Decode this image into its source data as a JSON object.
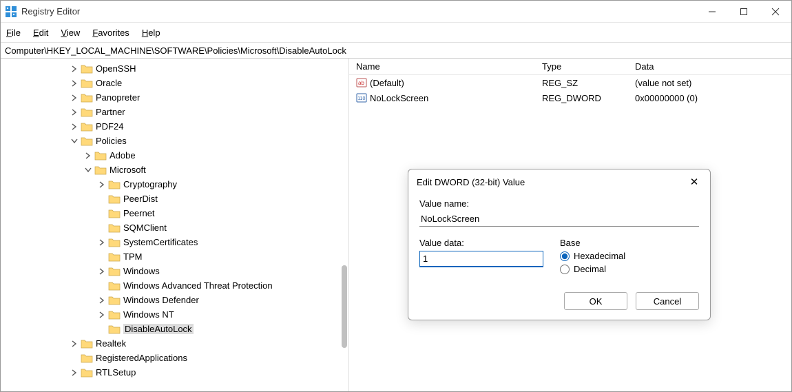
{
  "window": {
    "title": "Registry Editor"
  },
  "menu": {
    "file": "File",
    "edit": "Edit",
    "view": "View",
    "favorites": "Favorites",
    "help": "Help"
  },
  "address": "Computer\\HKEY_LOCAL_MACHINE\\SOFTWARE\\Policies\\Microsoft\\DisableAutoLock",
  "tree": {
    "items": [
      {
        "label": "OpenSSH",
        "depth": 3,
        "chev": ">"
      },
      {
        "label": "Oracle",
        "depth": 3,
        "chev": ">"
      },
      {
        "label": "Panopreter",
        "depth": 3,
        "chev": ">"
      },
      {
        "label": "Partner",
        "depth": 3,
        "chev": ">"
      },
      {
        "label": "PDF24",
        "depth": 3,
        "chev": ">"
      },
      {
        "label": "Policies",
        "depth": 3,
        "chev": "v"
      },
      {
        "label": "Adobe",
        "depth": 4,
        "chev": ">"
      },
      {
        "label": "Microsoft",
        "depth": 4,
        "chev": "v"
      },
      {
        "label": "Cryptography",
        "depth": 5,
        "chev": ">"
      },
      {
        "label": "PeerDist",
        "depth": 5,
        "chev": ""
      },
      {
        "label": "Peernet",
        "depth": 5,
        "chev": ""
      },
      {
        "label": "SQMClient",
        "depth": 5,
        "chev": ""
      },
      {
        "label": "SystemCertificates",
        "depth": 5,
        "chev": ">"
      },
      {
        "label": "TPM",
        "depth": 5,
        "chev": ""
      },
      {
        "label": "Windows",
        "depth": 5,
        "chev": ">"
      },
      {
        "label": "Windows Advanced Threat Protection",
        "depth": 5,
        "chev": ""
      },
      {
        "label": "Windows Defender",
        "depth": 5,
        "chev": ">"
      },
      {
        "label": "Windows NT",
        "depth": 5,
        "chev": ">"
      },
      {
        "label": "DisableAutoLock",
        "depth": 5,
        "chev": "",
        "selected": true
      },
      {
        "label": "Realtek",
        "depth": 3,
        "chev": ">"
      },
      {
        "label": "RegisteredApplications",
        "depth": 3,
        "chev": ""
      },
      {
        "label": "RTLSetup",
        "depth": 3,
        "chev": ">"
      }
    ]
  },
  "values": {
    "headers": {
      "name": "Name",
      "type": "Type",
      "data": "Data"
    },
    "rows": [
      {
        "icon": "sz",
        "name": "(Default)",
        "type": "REG_SZ",
        "data": "(value not set)"
      },
      {
        "icon": "dw",
        "name": "NoLockScreen",
        "type": "REG_DWORD",
        "data": "0x00000000 (0)"
      }
    ]
  },
  "dialog": {
    "title": "Edit DWORD (32-bit) Value",
    "valueNameLabel": "Value name:",
    "valueName": "NoLockScreen",
    "valueDataLabel": "Value data:",
    "valueData": "1",
    "baseLabel": "Base",
    "hex": "Hexadecimal",
    "dec": "Decimal",
    "ok": "OK",
    "cancel": "Cancel"
  }
}
